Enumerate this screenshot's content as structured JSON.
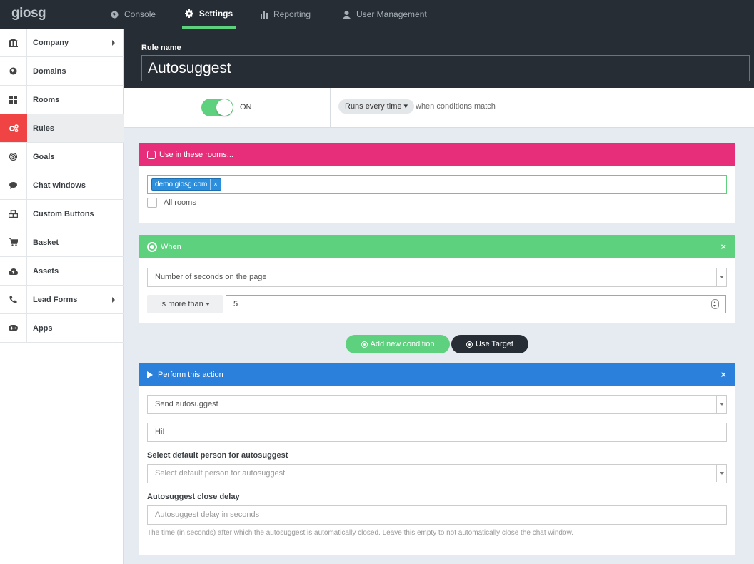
{
  "app": {
    "logo": "giosg"
  },
  "nav": [
    {
      "label": "Console",
      "icon": "globe-icon"
    },
    {
      "label": "Settings",
      "icon": "gear-icon",
      "active": true
    },
    {
      "label": "Reporting",
      "icon": "bar-chart-icon"
    },
    {
      "label": "User Management",
      "icon": "user-icon"
    }
  ],
  "sidebar": {
    "items": [
      {
        "label": "Company",
        "icon": "bank-icon",
        "submenu": true
      },
      {
        "label": "Domains",
        "icon": "globe-icon"
      },
      {
        "label": "Rooms",
        "icon": "grid-icon"
      },
      {
        "label": "Rules",
        "icon": "gears-icon",
        "active": true
      },
      {
        "label": "Goals",
        "icon": "target-icon"
      },
      {
        "label": "Chat windows",
        "icon": "chat-bubble-icon"
      },
      {
        "label": "Custom Buttons",
        "icon": "cubes-icon"
      },
      {
        "label": "Basket",
        "icon": "cart-icon"
      },
      {
        "label": "Assets",
        "icon": "cloud-upload-icon"
      },
      {
        "label": "Lead Forms",
        "icon": "phone-icon",
        "submenu": true
      },
      {
        "label": "Apps",
        "icon": "gamepad-icon"
      }
    ]
  },
  "rule": {
    "name_label": "Rule name",
    "name_value": "Autosuggest",
    "toggle_state": "ON",
    "runs_label": "Runs every time ▾",
    "runs_suffix": "when conditions match"
  },
  "rooms_panel": {
    "title": "Use in these rooms...",
    "color": "#e62e7a",
    "tag": "demo.giosg.com",
    "tag_remove": "×",
    "all_rooms_label": "All rooms"
  },
  "when_panel": {
    "title": "When",
    "color": "#5dd17e",
    "close": "×",
    "condition": "Number of seconds on the page",
    "operator": "is more than",
    "value": "5"
  },
  "buttons": {
    "add_condition": "Add new condition",
    "use_target": "Use Target"
  },
  "action_panel": {
    "title": "Perform this action",
    "color": "#2b80dc",
    "close": "×",
    "action": "Send autosuggest",
    "message_value": "Hi!",
    "person_label": "Select default person for autosuggest",
    "person_placeholder": "Select default person for autosuggest",
    "delay_label": "Autosuggest close delay",
    "delay_placeholder": "Autosuggest delay in seconds",
    "delay_help": "The time (in seconds) after which the autosuggest is automatically closed. Leave this empty to not automatically close the chat window."
  }
}
